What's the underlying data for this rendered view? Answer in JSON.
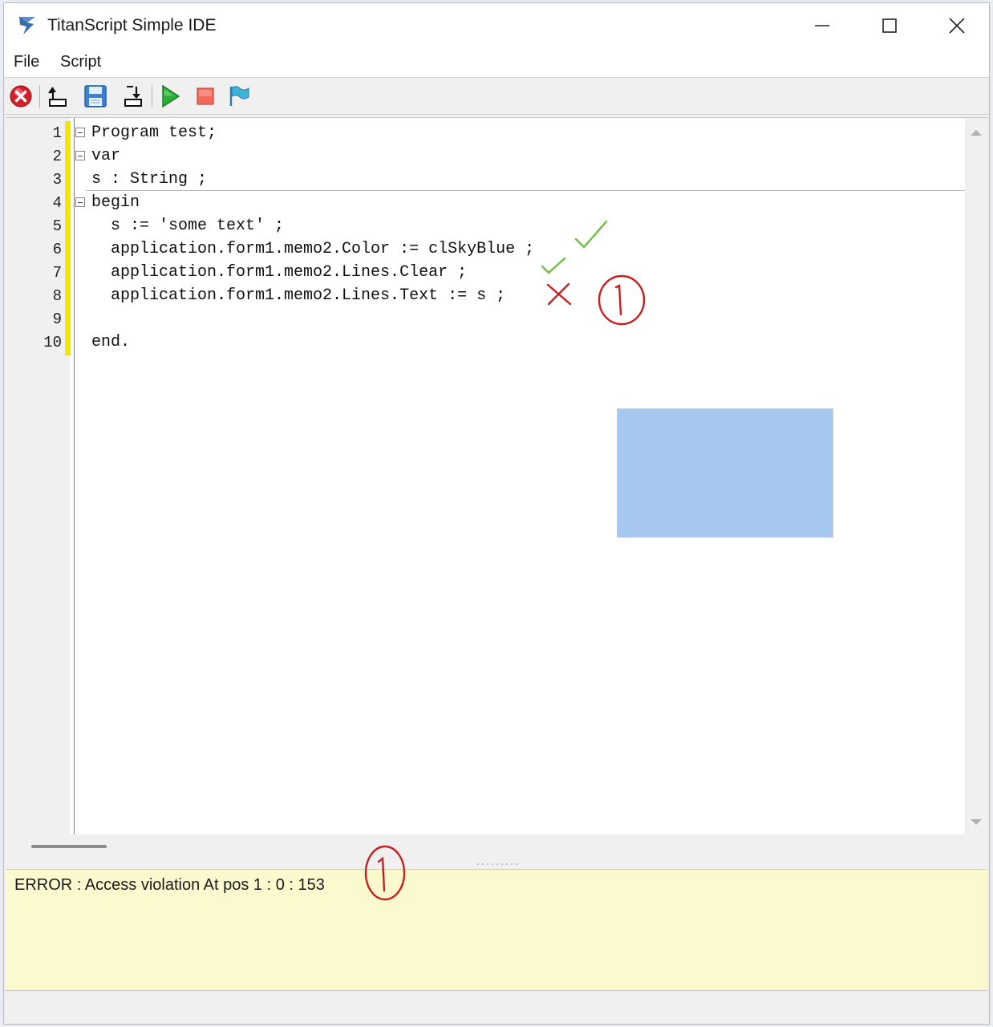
{
  "window": {
    "title": "TitanScript Simple IDE",
    "controls": [
      "minimize",
      "maximize",
      "close"
    ]
  },
  "menu": {
    "items": [
      {
        "label": "File"
      },
      {
        "label": "Script"
      }
    ]
  },
  "toolbar": {
    "buttons": [
      {
        "icon": "stop-error-icon"
      },
      {
        "icon": "open-file-icon"
      },
      {
        "icon": "save-floppy-icon"
      },
      {
        "icon": "export-download-icon"
      },
      {
        "icon": "run-play-icon"
      },
      {
        "icon": "stop-square-icon"
      },
      {
        "icon": "flag-icon"
      }
    ]
  },
  "editor": {
    "lines": [
      {
        "num": "1",
        "text": "Program test;"
      },
      {
        "num": "2",
        "text": "var"
      },
      {
        "num": "3",
        "text": "s : String ;"
      },
      {
        "num": "4",
        "text": "begin"
      },
      {
        "num": "5",
        "text": "  s := 'some text' ;"
      },
      {
        "num": "6",
        "text": "  application.form1.memo2.Color := clSkyBlue ;"
      },
      {
        "num": "7",
        "text": "  application.form1.memo2.Lines.Clear ;"
      },
      {
        "num": "8",
        "text": "  application.form1.memo2.Lines.Text := s ;"
      },
      {
        "num": "9",
        "text": ""
      },
      {
        "num": "10",
        "text": "end."
      }
    ]
  },
  "output": {
    "message": "ERROR : Access violation At pos 1 : 0 : 153"
  },
  "memo_preview": {
    "color": "#a6c8f0"
  },
  "annotations": {
    "marker_label": "1",
    "check_color": "#6cbf3c",
    "ink_color": "#c81e1e"
  }
}
